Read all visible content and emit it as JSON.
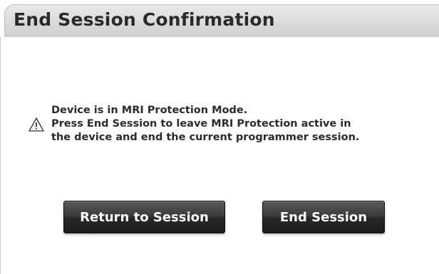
{
  "dialog": {
    "title": "End Session Confirmation",
    "icon": "warning-icon",
    "message_lines": [
      "Device is in MRI Protection Mode.",
      "Press End Session to leave MRI Protection active in",
      "the device and end the current programmer session."
    ]
  },
  "buttons": {
    "return_label": "Return to Session",
    "end_label": "End Session"
  }
}
